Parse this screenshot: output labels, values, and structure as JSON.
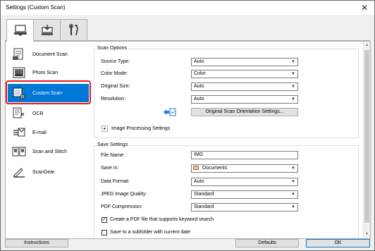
{
  "window": {
    "title": "Settings (Custom Scan)",
    "close_glyph": "✕"
  },
  "tabs": [
    {
      "name": "scan-from-computer-tab",
      "icon": "computer-scan-icon"
    },
    {
      "name": "scan-from-panel-tab",
      "icon": "panel-scan-icon"
    },
    {
      "name": "general-settings-tab",
      "icon": "tools-icon"
    }
  ],
  "sidebar": {
    "items": [
      {
        "label": "Document Scan",
        "icon": "document-scan-icon"
      },
      {
        "label": "Photo Scan",
        "icon": "photo-scan-icon"
      },
      {
        "label": "Custom Scan",
        "icon": "custom-scan-icon",
        "selected": true
      },
      {
        "label": "OCR",
        "icon": "ocr-icon"
      },
      {
        "label": "E-mail",
        "icon": "email-icon"
      },
      {
        "label": "Scan and Stitch",
        "icon": "scan-stitch-icon"
      },
      {
        "label": "ScanGear",
        "icon": "scangear-icon"
      }
    ]
  },
  "scan_options": {
    "title": "Scan Options",
    "source_type": {
      "label": "Source Type:",
      "value": "Auto"
    },
    "color_mode": {
      "label": "Color Mode:",
      "value": "Color"
    },
    "original_size": {
      "label": "Original Size:",
      "value": "Auto"
    },
    "resolution": {
      "label": "Resolution:",
      "value": "Auto"
    },
    "orientation_button": "Original Scan Orientation Settings...",
    "image_processing": {
      "toggle": "+",
      "label": "Image Processing Settings"
    }
  },
  "save_settings": {
    "title": "Save Settings",
    "file_name": {
      "label": "File Name:",
      "value": "IMG"
    },
    "save_in": {
      "label": "Save in:",
      "value": "Documents"
    },
    "data_format": {
      "label": "Data Format:",
      "value": "Auto"
    },
    "jpeg_quality": {
      "label": "JPEG Image Quality:",
      "value": "Standard"
    },
    "pdf_compression": {
      "label": "PDF Compression:",
      "value": "Standard"
    },
    "keyword_pdf": {
      "label": "Create a PDF file that supports keyword search",
      "checked": true
    },
    "subfolder": {
      "label": "Save to a subfolder with current date",
      "checked": false
    }
  },
  "footer": {
    "instructions": "Instructions",
    "defaults": "Defaults",
    "ok": "OK"
  },
  "colors": {
    "selected": "#0078d7",
    "highlight_outline": "#e8171e"
  }
}
